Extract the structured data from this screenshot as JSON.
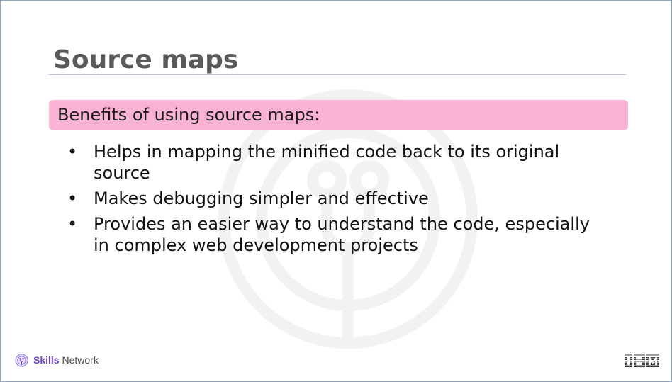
{
  "slide": {
    "title": "Source maps",
    "highlight": "Benefits of using source maps:",
    "bullets": [
      "Helps in mapping the minified code back to its original source",
      "Makes debugging simpler and effective",
      "Provides an easier way to understand the code, especially in complex web development projects"
    ],
    "bullet_symbol": "•"
  },
  "footer": {
    "brand_primary": "Skills",
    "brand_secondary": "Network",
    "company_logo": "IBM"
  },
  "colors": {
    "title_text": "#5a5a5a",
    "highlight_background": "#f8b2d3",
    "brand_purple": "#6a42c9",
    "slide_border": "#8fa7c7"
  },
  "icons": {
    "watermark": "skills-network-watermark-icon",
    "brand": "skills-network-logo-icon",
    "company": "ibm-logo-icon"
  }
}
